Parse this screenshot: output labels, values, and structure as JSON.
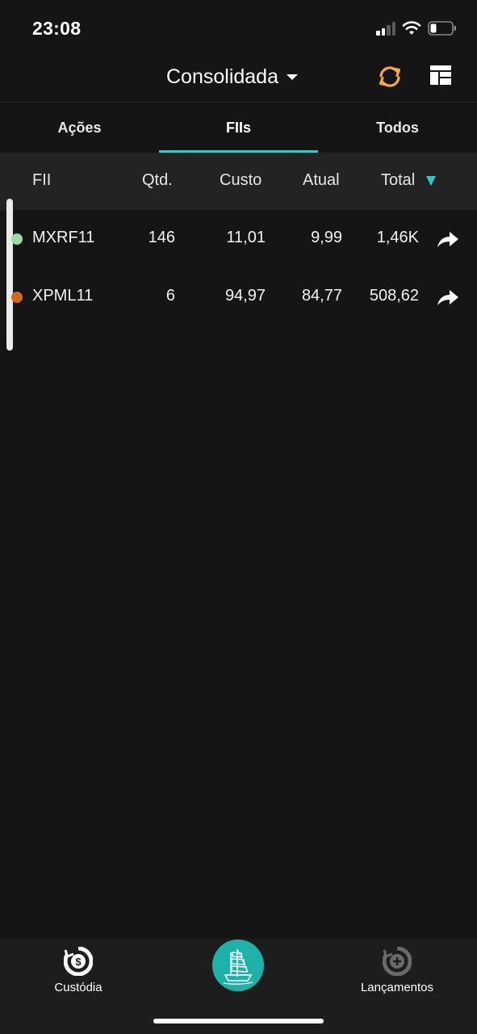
{
  "status_bar": {
    "time": "23:08"
  },
  "header": {
    "title": "Consolidada",
    "sync_icon": "sync-icon",
    "layout_icon": "dashboard-layout-icon"
  },
  "tabs": [
    {
      "label": "Ações",
      "active": false
    },
    {
      "label": "FIIs",
      "active": true
    },
    {
      "label": "Todos",
      "active": false
    }
  ],
  "table": {
    "columns": [
      "FII",
      "Qtd.",
      "Custo",
      "Atual",
      "Total"
    ],
    "sort_column": "Total",
    "rows": [
      {
        "ticker": "MXRF11",
        "qtd": "146",
        "custo": "11,01",
        "atual": "9,99",
        "total": "1,46K",
        "color": "#9fd9a8"
      },
      {
        "ticker": "XPML11",
        "qtd": "6",
        "custo": "94,97",
        "atual": "84,77",
        "total": "508,62",
        "color": "#d2691e"
      }
    ]
  },
  "bottom_nav": {
    "left": {
      "label": "Custódia",
      "icon": "custody-dollar-icon"
    },
    "center": {
      "icon": "ship-logo-icon"
    },
    "right": {
      "label": "Lançamentos",
      "icon": "add-entry-icon"
    }
  },
  "colors": {
    "accent": "#3fc3c3",
    "sync": "#f0a84a",
    "background": "#151515"
  }
}
